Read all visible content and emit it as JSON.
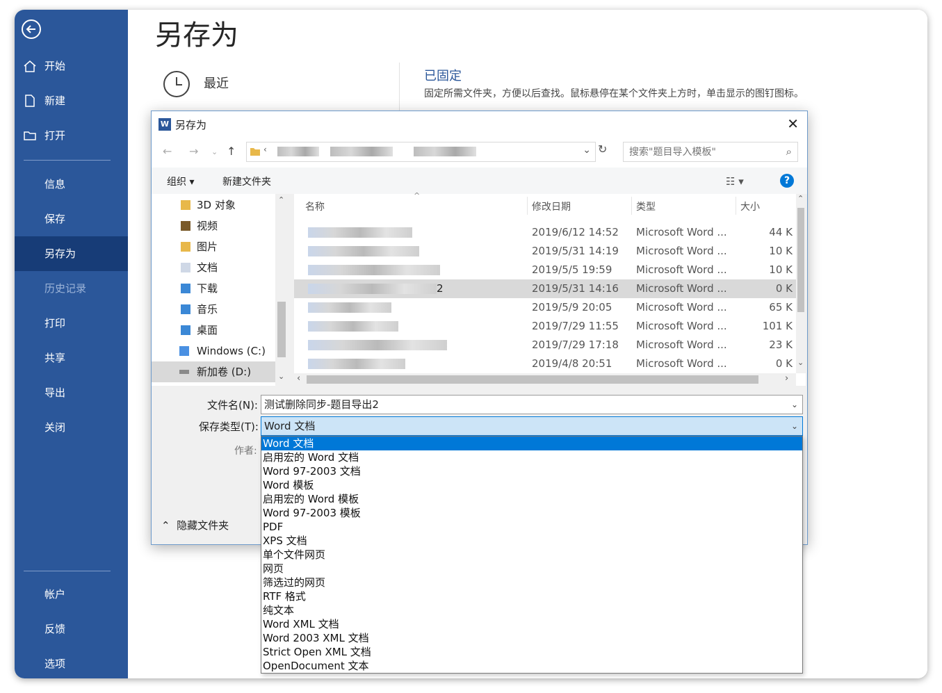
{
  "backstage": {
    "title": "另存为",
    "nav_top": [
      "开始",
      "新建",
      "打开"
    ],
    "nav_mid": [
      "信息",
      "保存",
      "另存为",
      "历史记录",
      "打印",
      "共享",
      "导出",
      "关闭"
    ],
    "nav_bottom": [
      "帐户",
      "反馈",
      "选项"
    ],
    "recent_label": "最近",
    "pinned_heading": "已固定",
    "pinned_desc": "固定所需文件夹，方便以后查找。鼠标悬停在某个文件夹上方时，单击显示的图钉图标。"
  },
  "dialog": {
    "title": "另存为",
    "search_placeholder": "搜索\"题目导入模板\"",
    "toolbar": {
      "organize": "组织 ▾",
      "new_folder": "新建文件夹"
    },
    "tree": [
      "3D 对象",
      "视频",
      "图片",
      "文档",
      "下载",
      "音乐",
      "桌面",
      "Windows (C:)",
      "新加卷 (D:)"
    ],
    "columns": {
      "name": "名称",
      "date": "修改日期",
      "type": "类型",
      "size": "大小"
    },
    "files": [
      {
        "suffix": "",
        "date": "2019/6/12 14:52",
        "type": "Microsoft Word ...",
        "size": "44 K"
      },
      {
        "suffix": "",
        "date": "2019/5/31 14:19",
        "type": "Microsoft Word ...",
        "size": "10 K"
      },
      {
        "suffix": "",
        "date": "2019/5/5 19:59",
        "type": "Microsoft Word ...",
        "size": "10 K"
      },
      {
        "suffix": "2",
        "date": "2019/5/31 14:16",
        "type": "Microsoft Word ...",
        "size": "0 K"
      },
      {
        "suffix": "",
        "date": "2019/5/9 20:05",
        "type": "Microsoft Word ...",
        "size": "65 K"
      },
      {
        "suffix": "",
        "date": "2019/7/29 11:55",
        "type": "Microsoft Word ...",
        "size": "101 K"
      },
      {
        "suffix": "",
        "date": "2019/7/29 17:18",
        "type": "Microsoft Word ...",
        "size": "23 K"
      },
      {
        "suffix": "",
        "date": "2019/4/8 20:51",
        "type": "Microsoft Word ...",
        "size": "0 K"
      }
    ],
    "filename_label": "文件名(N):",
    "filename_value": "测试删除同步-题目导出2",
    "savetype_label": "保存类型(T):",
    "savetype_value": "Word 文档",
    "author_label": "作者:",
    "hide_folders": "隐藏文件夹",
    "save_types": [
      "Word 文档",
      "启用宏的 Word 文档",
      "Word 97-2003 文档",
      "Word 模板",
      "启用宏的 Word 模板",
      "Word 97-2003 模板",
      "PDF",
      "XPS 文档",
      "单个文件网页",
      "网页",
      "筛选过的网页",
      "RTF 格式",
      "纯文本",
      "Word XML 文档",
      "Word 2003 XML 文档",
      "Strict Open XML 文档",
      "OpenDocument 文本"
    ]
  },
  "colors": {
    "sidebar": "#2b579a",
    "sidebar_active": "#173c77",
    "accent": "#0078d7"
  }
}
